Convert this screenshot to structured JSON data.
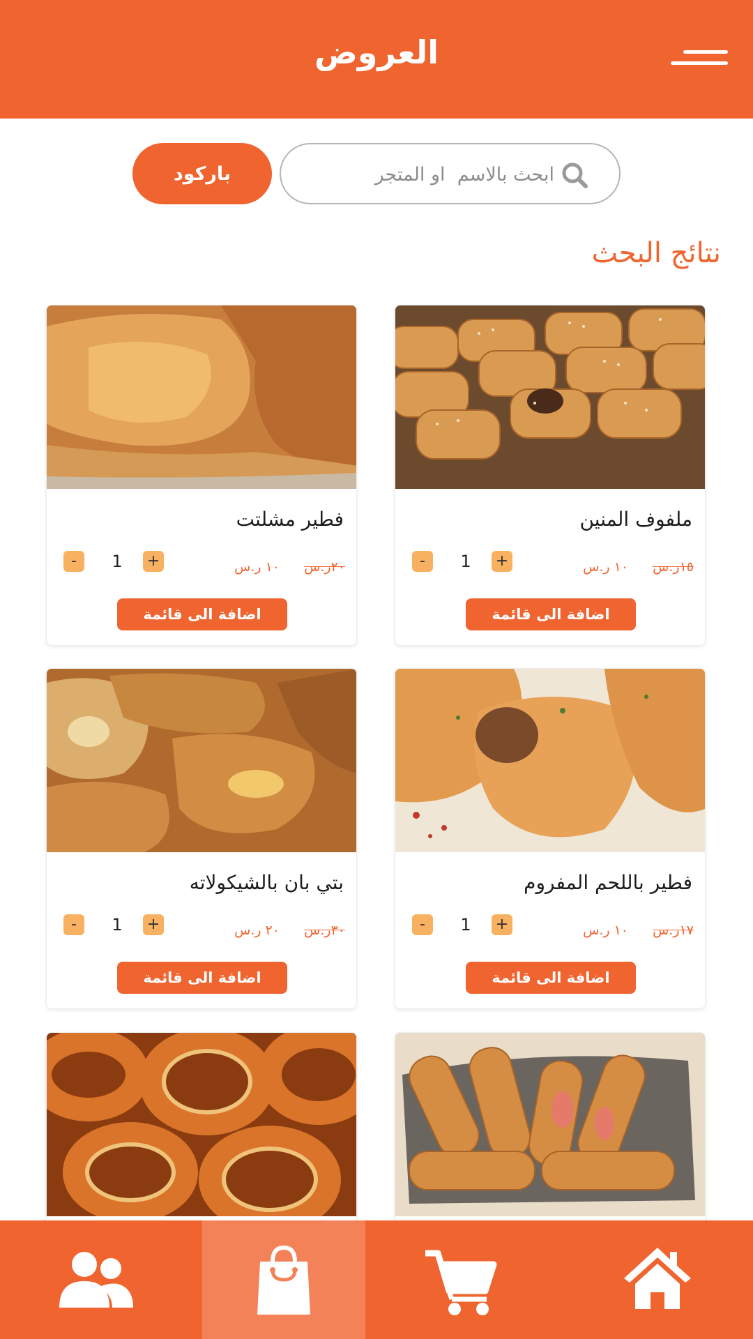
{
  "header": {
    "title": "العروض"
  },
  "search": {
    "placeholder": "ابحث بالاسم  او المتجر",
    "barcode_label": "باركود"
  },
  "results": {
    "title": "نتائج البحث"
  },
  "products": [
    {
      "name": "ملفوف المنين",
      "old_price": "١٥ر.س",
      "new_price": "١٠ ر.س",
      "qty": "1",
      "add_label": "اضافة الى قائمة"
    },
    {
      "name": "فطير مشلتت",
      "old_price": "٢٠ر.س",
      "new_price": "١٠ ر.س",
      "qty": "1",
      "add_label": "اضافة الى قائمة"
    },
    {
      "name": "فطير باللحم المفروم",
      "old_price": "١٧ر.س",
      "new_price": "١٠ ر.س",
      "qty": "1",
      "add_label": "اضافة الى قائمة"
    },
    {
      "name": "بتي بان بالشيكولاته",
      "old_price": "٣٠ر.س",
      "new_price": "٢٠ ر.س",
      "qty": "1",
      "add_label": "اضافة الى قائمة"
    }
  ],
  "images": {
    "p1": "sausage-rolls-photo",
    "p2": "layered-pastry-photo",
    "p3": "meat-pies-photo",
    "p4": "croissant-pastry-photo",
    "p5": "sausage-bread-rolls-photo",
    "p6": "simit-rings-photo"
  },
  "bottom_nav": [
    {
      "icon": "home-icon",
      "active": false
    },
    {
      "icon": "cart-icon",
      "active": false
    },
    {
      "icon": "shopping-bag-icon",
      "active": true
    },
    {
      "icon": "users-icon",
      "active": false
    }
  ],
  "colors": {
    "primary": "#F06430",
    "active_tab": "#F48258",
    "qty_button": "#F8B160"
  },
  "qty_symbols": {
    "plus": "+",
    "minus": "-"
  }
}
